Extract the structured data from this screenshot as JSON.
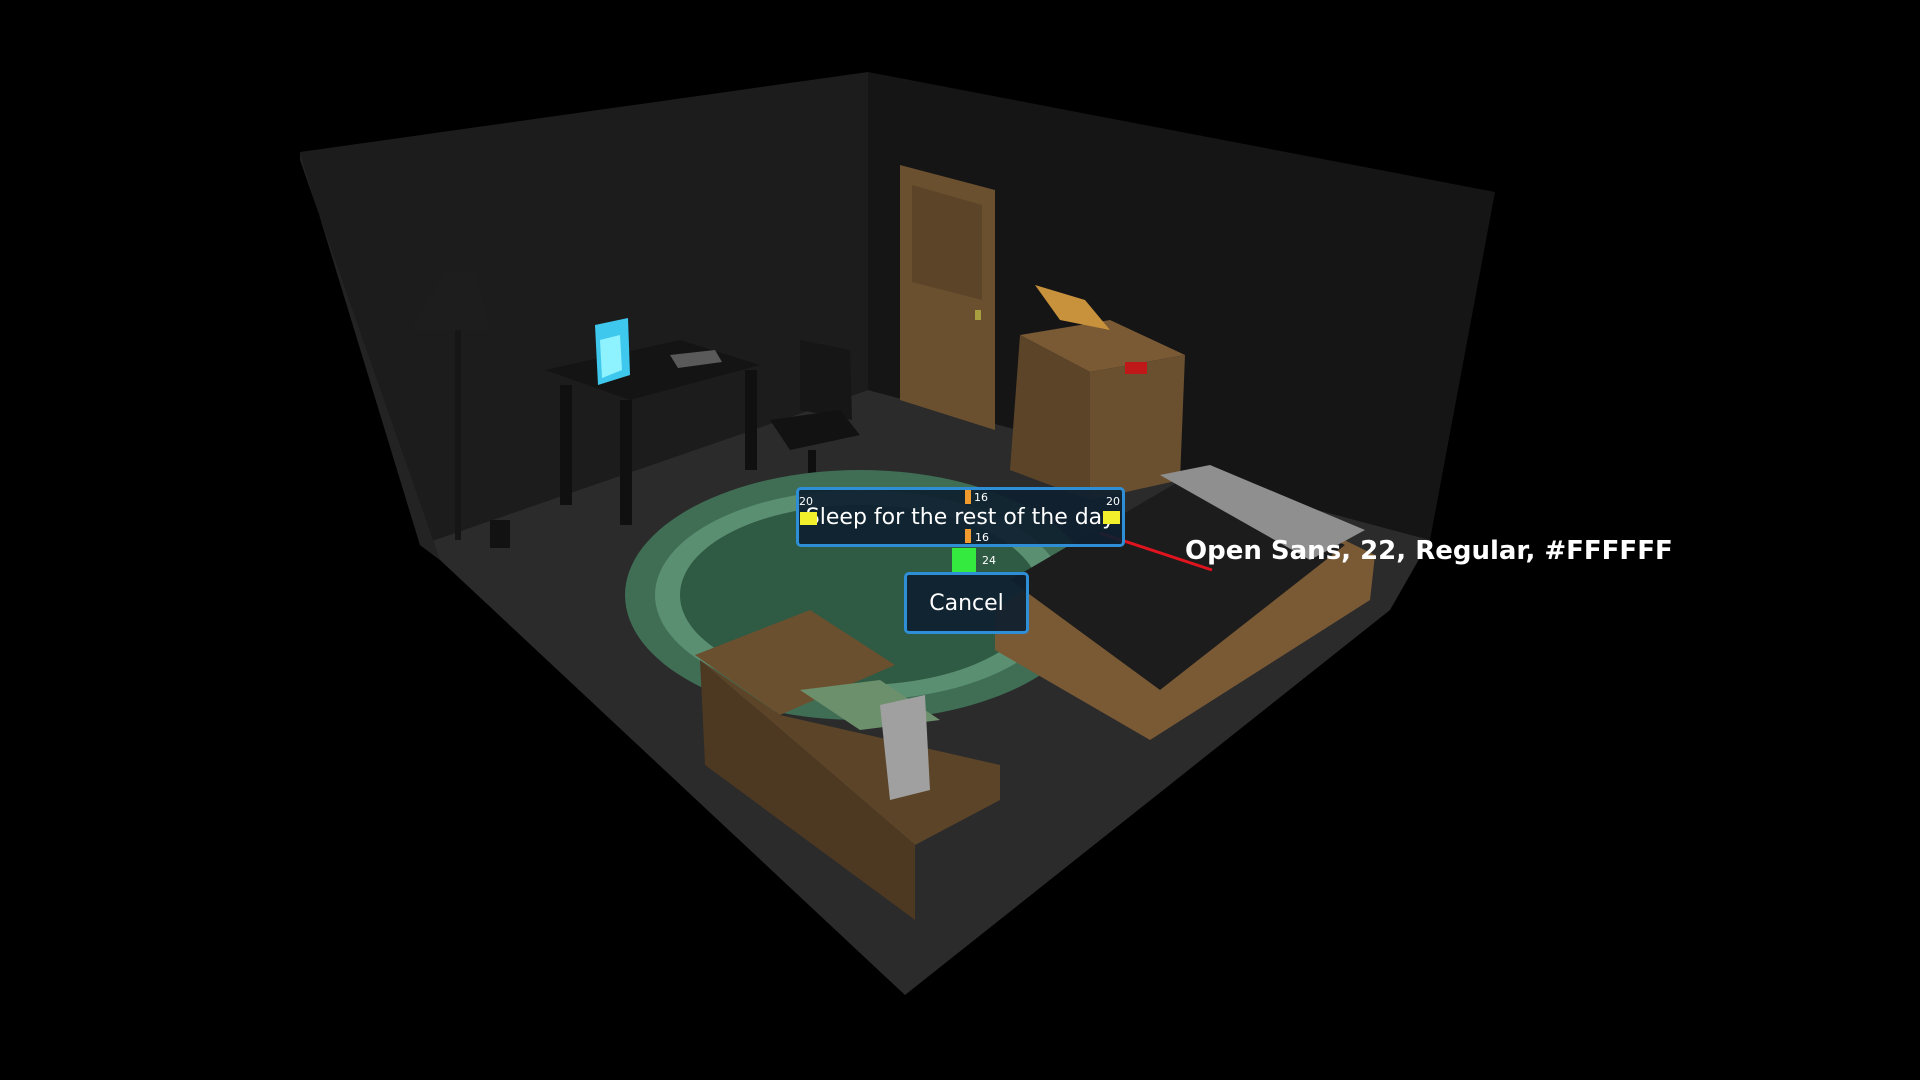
{
  "dialog": {
    "sleep_label": "Sleep for the rest of the day",
    "cancel_label": "Cancel"
  },
  "spacing_marks": {
    "left_padding": "20",
    "right_padding": "20",
    "top_padding": "16",
    "bottom_padding": "16",
    "button_gap": "24"
  },
  "annotation": {
    "text": "Open Sans, 22, Regular, #FFFFFF",
    "leader_color": "#e0141e"
  },
  "colors": {
    "button_border": "#2f8fd6",
    "button_fill": "#0e2030",
    "padding_mark": "#f2ef2c",
    "vertical_mark": "#f19a2d",
    "gap_mark": "#35ea3f"
  }
}
